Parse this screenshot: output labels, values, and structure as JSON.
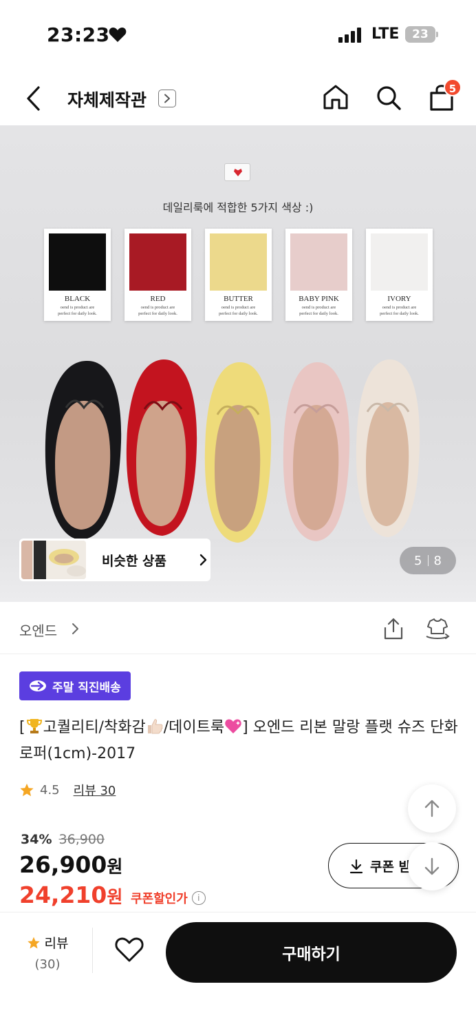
{
  "status_bar": {
    "time": "23:23",
    "network": "LTE",
    "battery": "23"
  },
  "nav": {
    "title": "자체제작관",
    "cart_count": "5"
  },
  "hero": {
    "caption": "데일리룩에 적합한 5가지 색상 :)",
    "swatch_desc_line1": "oend is product are",
    "swatch_desc_line2": "perfect for daily look.",
    "swatches": [
      {
        "name": "BLACK",
        "color": "#0e0e0e"
      },
      {
        "name": "RED",
        "color": "#a81a24"
      },
      {
        "name": "BUTTER",
        "color": "#ecd98c"
      },
      {
        "name": "BABY PINK",
        "color": "#e7cdcb"
      },
      {
        "name": "IVORY",
        "color": "#f1f0ef"
      }
    ],
    "similar_label": "비슷한 상품",
    "image_index": "5",
    "image_total": "8"
  },
  "brand": {
    "name": "오엔드"
  },
  "product": {
    "tag": "주말 직진배송",
    "title_part1": "[",
    "title_part2": "고퀄리티/착화감",
    "title_part3": "/데이트룩",
    "title_part4": "] 오엔드 리본 말랑 플랫 슈즈 단화 로퍼(1cm)-2017",
    "rating": "4.5",
    "review_link": "리뷰 30",
    "discount_pct": "34%",
    "original_price": "36,900",
    "price": "26,900",
    "price_unit": "원",
    "coupon_price": "24,210",
    "coupon_price_label": "쿠폰할인가",
    "coupon_button": "쿠폰 받"
  },
  "bottom_bar": {
    "review_label": "리뷰",
    "review_count": "(30)",
    "buy_label": "구매하기"
  }
}
